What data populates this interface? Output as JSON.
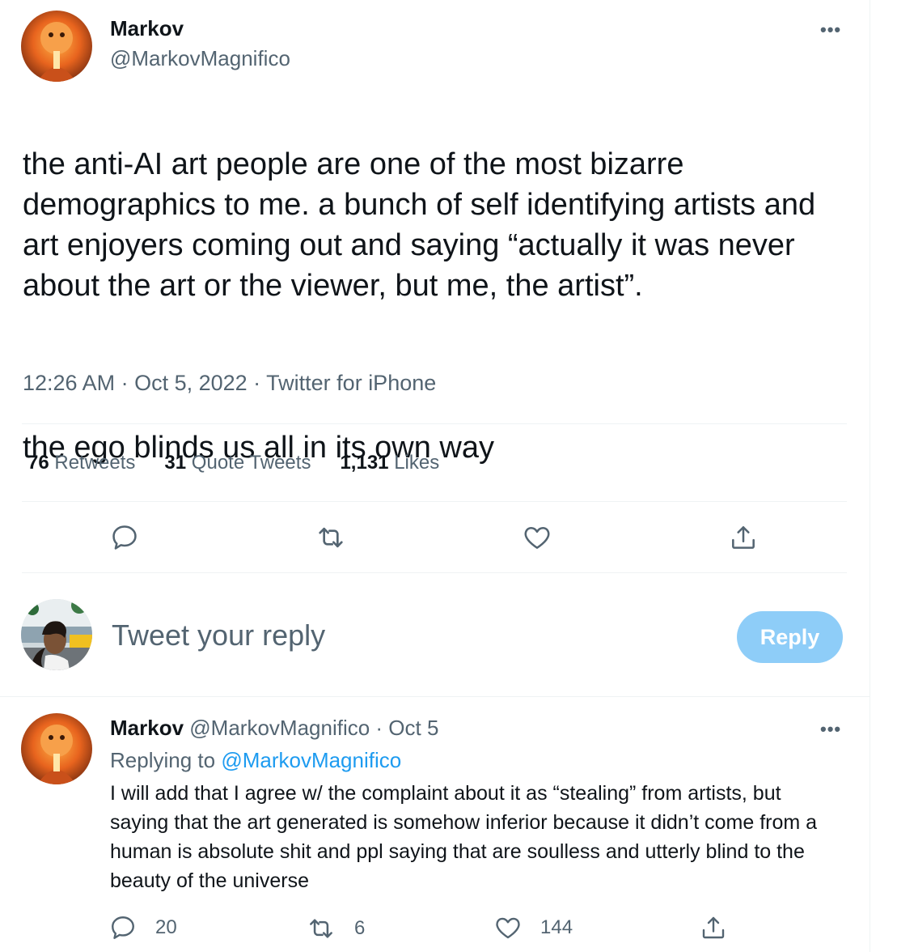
{
  "tweet": {
    "author_name": "Markov",
    "author_handle": "@MarkovMagnifico",
    "more_icon": "more-icon",
    "text_p1": "the anti-AI art people are one of the most bizarre demographics to me. a bunch of self identifying artists and art enjoyers coming out and saying “actually it was never about the art or the viewer, but me, the artist”.",
    "text_p2": "the ego blinds us all in its own way",
    "meta": "12:26 AM · Oct 5, 2022 · Twitter for iPhone",
    "stats": {
      "retweets_count": "76",
      "retweets_label": "Retweets",
      "quotes_count": "31",
      "quotes_label": "Quote Tweets",
      "likes_count": "1,131",
      "likes_label": "Likes"
    }
  },
  "composer": {
    "placeholder": "Tweet your reply",
    "button_label": "Reply"
  },
  "reply": {
    "author_name": "Markov",
    "author_handle": "@MarkovMagnifico",
    "date": "· Oct 5",
    "replying_prefix": "Replying to",
    "replying_handle": "@MarkovMagnifico",
    "text": "I will add that I agree w/ the complaint about it as “stealing” from artists, but saying that the art generated is somehow inferior because it didn’t come from a human is absolute shit and ppl saying that are soulless and utterly blind to the beauty of the universe",
    "reply_count": "20",
    "retweet_count": "6",
    "like_count": "144"
  },
  "colors": {
    "text_primary": "#0f1419",
    "text_secondary": "#536471",
    "link": "#1d9bf0",
    "reply_button": "#8ecdf8",
    "divider": "#eff3f4"
  }
}
